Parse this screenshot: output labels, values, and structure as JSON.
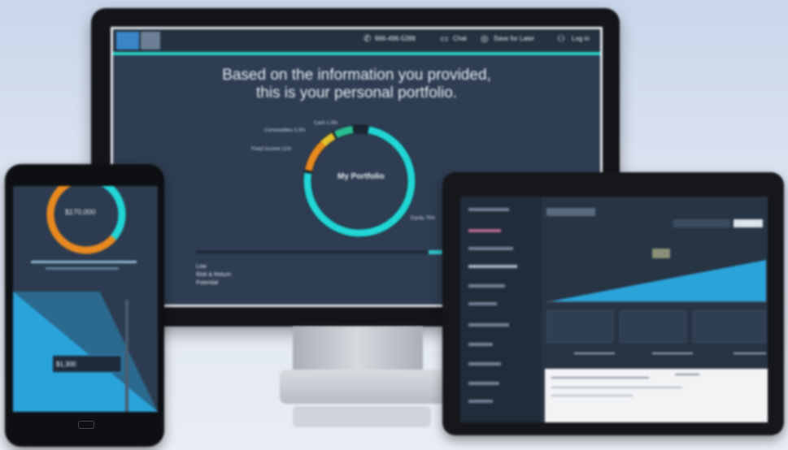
{
  "monitor": {
    "nav": {
      "phone": "866-496-5288",
      "chat": "Chat",
      "save": "Save for Later",
      "login": "Log in"
    },
    "headline_line1": "Based on the information you provided,",
    "headline_line2": "this is your personal portfolio.",
    "donut": {
      "center_label": "My Portfolio",
      "segments": [
        {
          "label": "Cash 1.3%",
          "color": "#2bbf8f"
        },
        {
          "label": "Commodities 4.3%",
          "color": "#e3c22a"
        },
        {
          "label": "Fixed Income 11%",
          "color": "#e8891f"
        },
        {
          "label": "Equity 75%",
          "color": "#22d6d6"
        }
      ]
    },
    "left_labels": [
      "Low",
      "Risk & Return",
      "Potential"
    ]
  },
  "phone": {
    "ring_label": "$170,000",
    "badge": "$1,300"
  },
  "colors": {
    "accent": "#29d3cc",
    "orange": "#e8891f",
    "blue": "#2aa3d9",
    "navy": "#2e3d52"
  }
}
